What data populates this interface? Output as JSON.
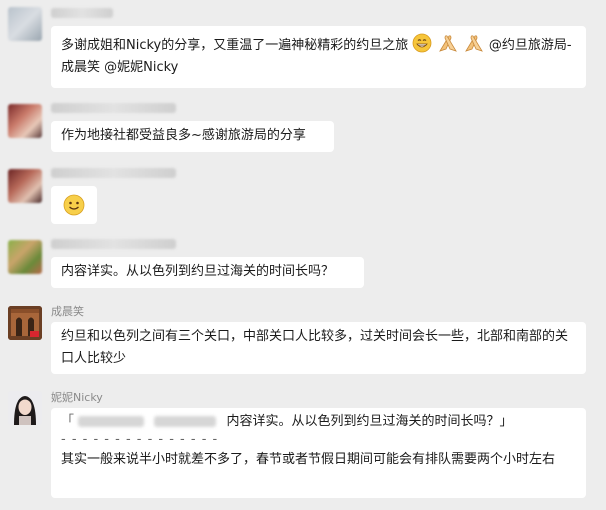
{
  "messages": [
    {
      "sender": "",
      "text_main": "多谢成姐和Nicky的分享，又重温了一遍神秘精彩的约旦之旅",
      "text_mention": "@约旦旅游局-成晨笑 @妮妮Nicky",
      "emojis": [
        "grin-emoji",
        "clap-hands-emoji",
        "clap-hands-emoji"
      ]
    },
    {
      "sender": "",
      "text": "作为地接社都受益良多~感谢旅游局的分享"
    },
    {
      "sender": "",
      "emoji": "smile-emoji"
    },
    {
      "sender": "",
      "text": "内容详实。从以色列到约旦过海关的时间长吗？"
    },
    {
      "sender": "成晨笑",
      "text": "约旦和以色列之间有三个关口，中部关口人比较多，过关时间会长一些，北部和南部的关口人比较少"
    },
    {
      "sender": "妮妮Nicky",
      "quote_text": "内容详实。从以色列到约旦过海关的时间长吗？」",
      "quote_open": "「",
      "divider": "- - - - - - - - - - - - - - -",
      "reply_text": "其实一般来说半小时就差不多了，春节或者节假日期间可能会有排队需要两个小时左右"
    }
  ],
  "colors": {
    "background": "#ededed",
    "bubble": "#ffffff",
    "sender_name": "#8a8a8a"
  }
}
